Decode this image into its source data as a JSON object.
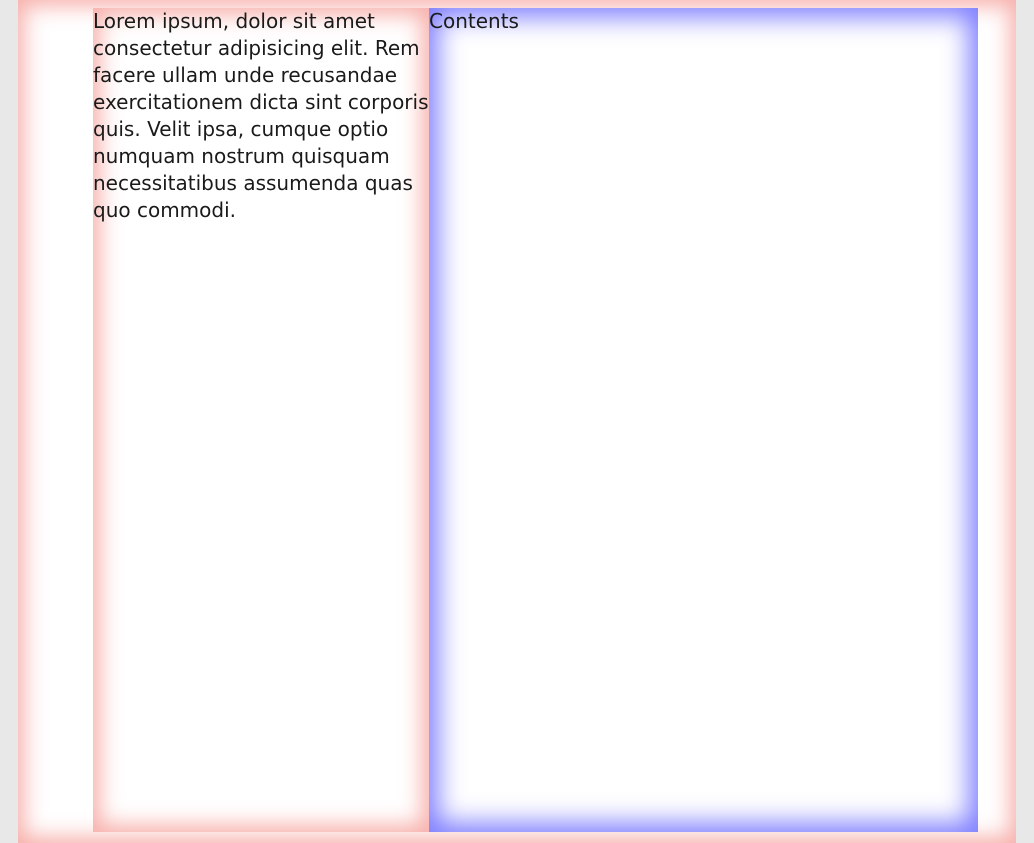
{
  "sidebar": {
    "text": "Lorem ipsum, dolor sit amet consectetur adipisicing elit. Rem facere ullam unde recusandae exercitationem dicta sint corporis quis. Velit ipsa, cumque optio numquam nostrum quisquam necessitatibus assumenda quas quo commodi."
  },
  "main": {
    "title": "Contents"
  },
  "colors": {
    "sidebar_glow": "#f06e64",
    "main_glow": "#4646ff",
    "page_glow": "#f06e64"
  }
}
